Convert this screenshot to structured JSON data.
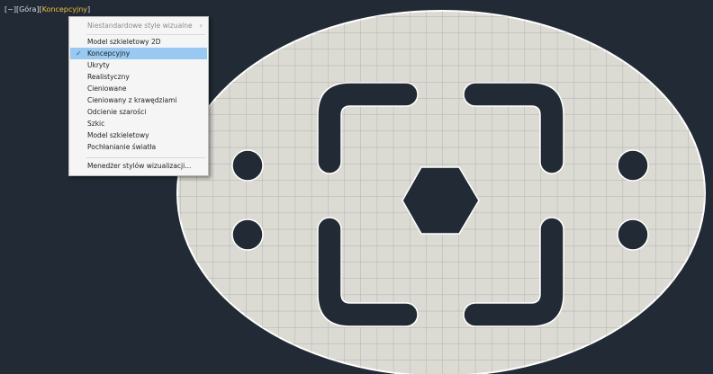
{
  "viewport_controls": {
    "prefix": "[−][",
    "view": "Góra",
    "middle": "][",
    "style": "Koncepcyjny",
    "suffix": "]"
  },
  "menu": {
    "submenu_item": "Niestandardowe style wizualne",
    "submenu_arrow": "›",
    "check_mark": "✓",
    "items": [
      "Model szkieletowy 2D",
      "Koncepcyjny",
      "Ukryty",
      "Realistyczny",
      "Cieniowane",
      "Cieniowany z krawędziami",
      "Odcienie szarości",
      "Szkic",
      "Model szkieletowy",
      "Pochłanianie światła"
    ],
    "selected": "Koncepcyjny",
    "manager": "Menedżer stylów wizualizacji..."
  },
  "colors": {
    "viewport_bg": "#222a35",
    "part_fill": "#dcdbd3",
    "grid_line": "#9ea3a8",
    "active_label": "#f0c040",
    "menu_highlight": "#99c9f1"
  }
}
